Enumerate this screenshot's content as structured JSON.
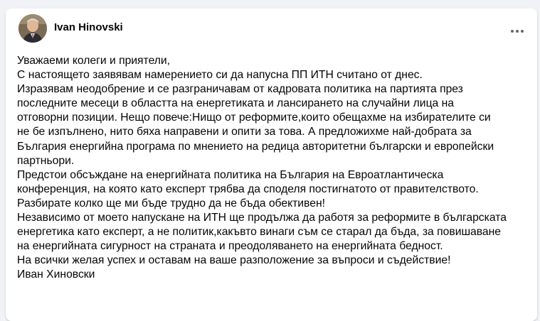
{
  "post": {
    "author_name": "Ivan Hinovski",
    "lines": [
      "Уважаеми колеги и приятели,",
      "С настоящето заявявам намерението си да напусна ПП ИТН считано от днес.",
      "Изразявам неодобрение и се разграничавам от кадровата политика на партията през",
      "последните месеци в областта на енергетиката и лансирането на случайни лица на",
      "отговорни позиции. Нещо повече:Нищо от реформите,които обещахме на избирателите си",
      "не бе изпълнено, нито бяха направени и опити за това. А предложихме най-добрата за",
      "България енергийна програма по мнението на редица авторитетни български и европейски",
      "партньори.",
      "Предстои обсъждане на енергийната политика на България на Евроатлантическа",
      "конференция, на която като експерт трябва да споделя постигнатото от правителството.",
      "Разбирате колко ще ми бъде трудно да не бъда обективен!",
      "Независимо от моето напускане на ИТН ще продължа да работя за реформите в българската",
      "енергетика като експерт, а не политик,какъвто винаги съм се старал да бъда, за повишаване",
      "на енергийната сигурност на страната и преодоляването на енергийната бедност.",
      "На всички желая успех и оставам на ваше разположение за въпроси и съдействие!",
      "Иван Хиновски"
    ]
  },
  "icons": {
    "avatar": "profile-photo",
    "more": "more-horizontal-icon"
  },
  "colors": {
    "background": "#f0f2f5",
    "card": "#ffffff",
    "text": "#050505",
    "icon": "#65676b"
  }
}
